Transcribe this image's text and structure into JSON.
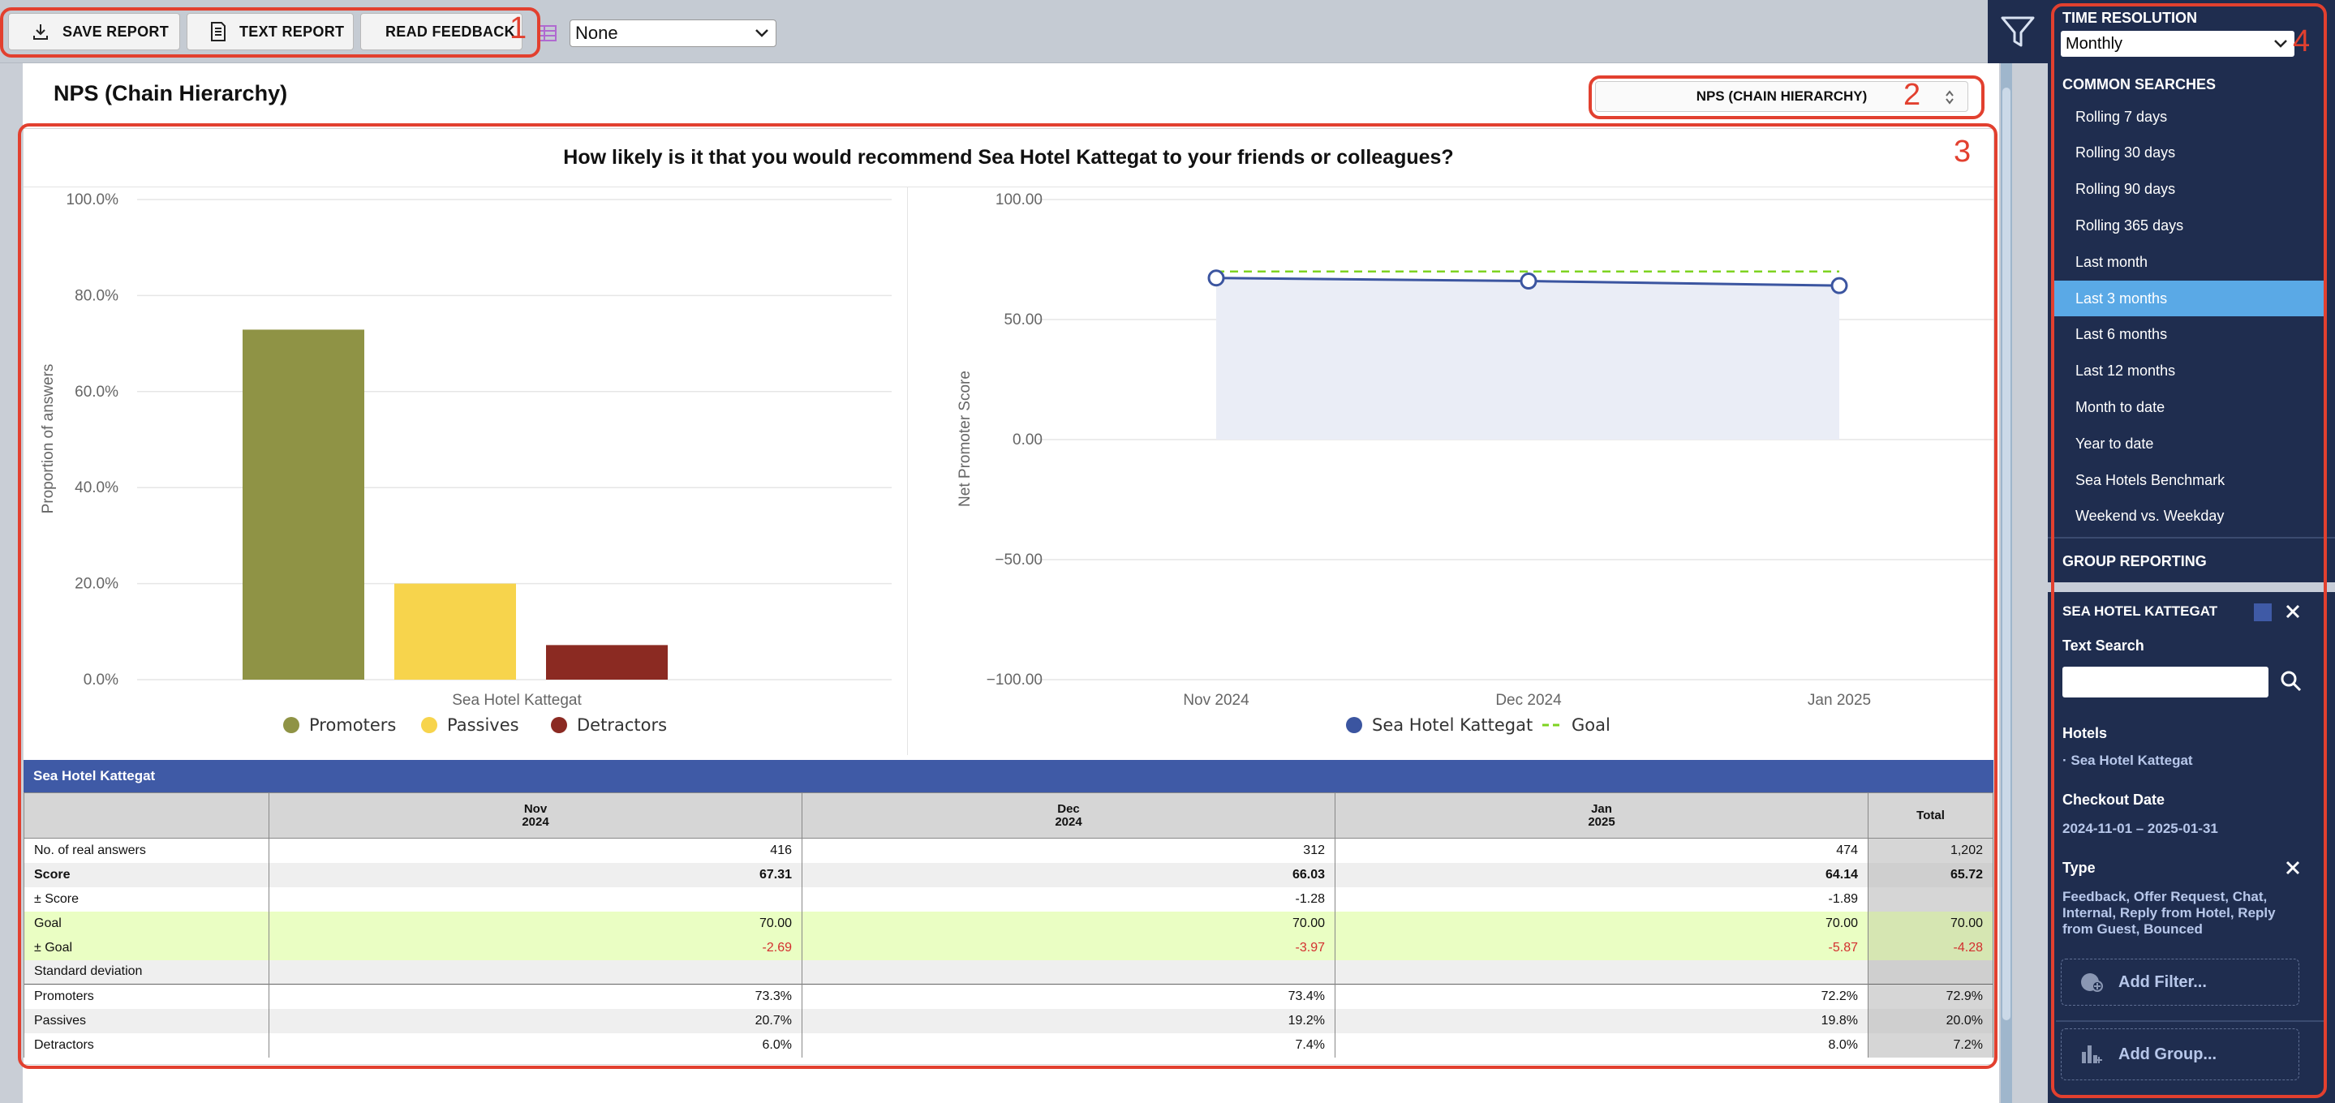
{
  "toolbar": {
    "save_label": "SAVE REPORT",
    "text_report_label": "TEXT REPORT",
    "read_feedback_label": "READ FEEDBACK",
    "scheme_value": "None"
  },
  "annotations": [
    "1",
    "2",
    "3",
    "4"
  ],
  "page": {
    "title": "NPS (Chain Hierarchy)",
    "view_select": "NPS (CHAIN HIERARCHY)",
    "question": "How likely is it that you would recommend Sea Hotel Kattegat to your friends or colleagues?"
  },
  "chart_data": [
    {
      "type": "bar",
      "ylabel": "Proportion of answers",
      "xlabel": "Sea Hotel Kattegat",
      "ylim": [
        0,
        100
      ],
      "yticks": [
        "100.0%",
        "80.0%",
        "60.0%",
        "40.0%",
        "20.0%",
        "0.0%"
      ],
      "categories": [
        "Sea Hotel Kattegat"
      ],
      "series": [
        {
          "name": "Promoters",
          "values": [
            72.9
          ],
          "color": "#8f9345"
        },
        {
          "name": "Passives",
          "values": [
            20.0
          ],
          "color": "#f7d44c"
        },
        {
          "name": "Detractors",
          "values": [
            7.2
          ],
          "color": "#8b2a22"
        }
      ],
      "legend": "bottom"
    },
    {
      "type": "line",
      "ylabel": "Net Promoter Score",
      "ylim": [
        -100,
        100
      ],
      "yticks": [
        "100.00",
        "50.00",
        "0.00",
        "−50.00",
        "−100.00"
      ],
      "x": [
        "Nov 2024",
        "Dec 2024",
        "Jan 2025"
      ],
      "series": [
        {
          "name": "Sea Hotel Kattegat",
          "values": [
            67.31,
            66.03,
            64.14
          ],
          "color": "#3b55a0"
        },
        {
          "name": "Goal",
          "values": [
            70.0,
            70.0,
            70.0
          ],
          "color": "#7ed321"
        }
      ],
      "legend": "bottom"
    }
  ],
  "table": {
    "title": "Sea Hotel Kattegat",
    "columns": [
      {
        "line1": "Nov",
        "line2": "2024"
      },
      {
        "line1": "Dec",
        "line2": "2024"
      },
      {
        "line1": "Jan",
        "line2": "2025"
      }
    ],
    "total_label": "Total",
    "rows": [
      {
        "label": "No. of real answers",
        "values": [
          "416",
          "312",
          "474"
        ],
        "total": "1,202"
      },
      {
        "label": "Score",
        "values": [
          "67.31",
          "66.03",
          "64.14"
        ],
        "total": "65.72"
      },
      {
        "label": "± Score",
        "values": [
          "",
          "-1.28",
          "-1.89"
        ],
        "total": ""
      },
      {
        "label": "Goal",
        "values": [
          "70.00",
          "70.00",
          "70.00"
        ],
        "total": "70.00"
      },
      {
        "label": "± Goal",
        "values": [
          "-2.69",
          "-3.97",
          "-5.87"
        ],
        "total": "-4.28"
      },
      {
        "label": "Standard deviation",
        "values": [
          "",
          "",
          ""
        ],
        "total": ""
      },
      {
        "label": "Promoters",
        "values": [
          "73.3%",
          "73.4%",
          "72.2%"
        ],
        "total": "72.9%"
      },
      {
        "label": "Passives",
        "values": [
          "20.7%",
          "19.2%",
          "19.8%"
        ],
        "total": "20.0%"
      },
      {
        "label": "Detractors",
        "values": [
          "6.0%",
          "7.4%",
          "8.0%"
        ],
        "total": "7.2%"
      }
    ]
  },
  "sidebar": {
    "time_resolution_label": "TIME RESOLUTION",
    "time_resolution_value": "Monthly",
    "common_searches_label": "COMMON SEARCHES",
    "common_searches": [
      "Rolling 7 days",
      "Rolling 30 days",
      "Rolling 90 days",
      "Rolling 365 days",
      "Last month",
      "Last 3 months",
      "Last 6 months",
      "Last 12 months",
      "Month to date",
      "Year to date",
      "Sea Hotels Benchmark",
      "Weekend vs. Weekday"
    ],
    "active_search": "Last 3 months",
    "group_reporting_label": "GROUP REPORTING",
    "group_name": "SEA HOTEL KATTEGAT",
    "group_color": "#3f5aa6",
    "text_search_label": "Text Search",
    "hotels_label": "Hotels",
    "hotels_value": "· Sea Hotel Kattegat",
    "checkout_label": "Checkout Date",
    "checkout_value": "2024-11-01 – 2025-01-31",
    "type_label": "Type",
    "type_value_1": "Feedback, Offer Request, Chat,",
    "type_value_2": "Internal, Reply from Hotel, Reply",
    "type_value_3": "from Guest, Bounced",
    "add_filter_label": "Add Filter...",
    "add_group_label": "Add Group..."
  }
}
